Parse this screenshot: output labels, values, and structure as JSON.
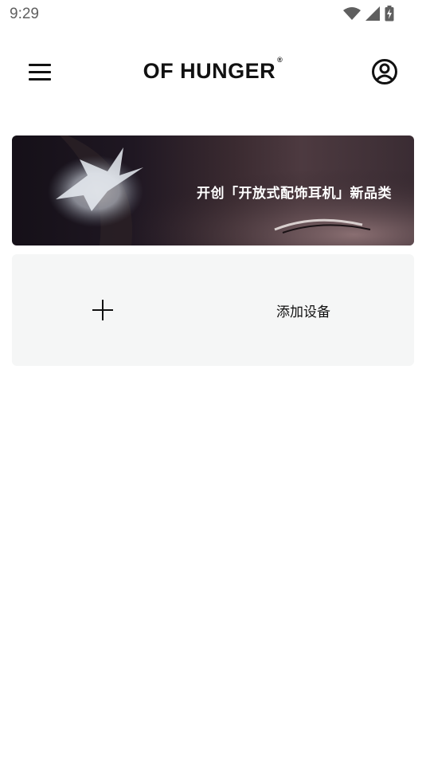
{
  "status_bar": {
    "time": "9:29"
  },
  "header": {
    "logo_text": "OF HUNGER",
    "logo_mark": "®"
  },
  "banner": {
    "text": "开创「开放式配饰耳机」新品类"
  },
  "device_card": {
    "add_label": "添加设备"
  },
  "icons": {
    "menu": "hamburger-menu-icon",
    "account": "user-circle-icon",
    "add": "plus-icon",
    "wifi": "wifi-icon",
    "signal": "cellular-signal-icon",
    "battery": "battery-charging-icon"
  },
  "colors": {
    "background": "#ffffff",
    "card_background": "#f5f6f6",
    "text": "#111111"
  }
}
